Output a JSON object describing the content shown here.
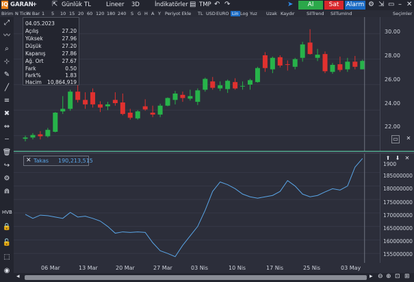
{
  "toolbar": {
    "symbol": "GARAN",
    "plus": "+",
    "period": "Günlük",
    "currency": "TL",
    "scale": "Lineer",
    "mode3d": "3D",
    "indicators": "İndikatörler",
    "template": "TMP",
    "buy": "Al",
    "sell": "Sat",
    "alarm": "Alarm"
  },
  "subbar": {
    "items": [
      "Birim",
      "N Tick",
      "N Bar",
      "1",
      "5",
      "10",
      "15",
      "20",
      "60",
      "120",
      "180",
      "240",
      "S",
      "G",
      "H",
      "A",
      "Y",
      "Periyot Ekle",
      "TL",
      "USD",
      "EURO",
      "Lin",
      "Log",
      "Yuz",
      "Uzak",
      "Kaydır",
      "SilTrend",
      "SilTumInd"
    ],
    "active": "Lin",
    "right_label": "Seçimler"
  },
  "info": {
    "date": "04.05.2023",
    "rows": [
      {
        "label": "Açılış",
        "value": "27.20"
      },
      {
        "label": "Yüksek",
        "value": "27.96"
      },
      {
        "label": "Düşük",
        "value": "27.20"
      },
      {
        "label": "Kapanış",
        "value": "27.86"
      },
      {
        "label": "Ağ. Ort",
        "value": "27.67"
      },
      {
        "label": "Fark",
        "value": "0.50"
      },
      {
        "label": "Fark%",
        "value": "1.83"
      },
      {
        "label": "Hacim",
        "value": "10,864,919"
      }
    ]
  },
  "indicator": {
    "name": "Takas",
    "value": "190,213,515",
    "color": "#5aa6e8"
  },
  "colors": {
    "up": "#27b34a",
    "down": "#e0312f",
    "accent": "#56c9a0",
    "line": "#5aa6e8"
  },
  "icons": {
    "left_tools": [
      "expand-icon",
      "trend-icon",
      "zoom-icon",
      "crosshair-icon",
      "pencil-icon",
      "line-tool-icon",
      "fibonacci-icon",
      "eraser-icon",
      "measure-icon",
      "trash-icon",
      "arrow-icon",
      "magnet-icon",
      "lock-icon",
      "eye-icon",
      "settings-icon"
    ],
    "top_right": [
      "gear-icon",
      "pin-icon",
      "window-icon"
    ]
  },
  "left_hvb": "HVB",
  "chart_data": [
    {
      "type": "candlestick",
      "title": "",
      "x": [
        "2023-02-28",
        "2023-03-01",
        "2023-03-02",
        "2023-03-03",
        "2023-03-06",
        "2023-03-07",
        "2023-03-08",
        "2023-03-09",
        "2023-03-10",
        "2023-03-13",
        "2023-03-14",
        "2023-03-15",
        "2023-03-16",
        "2023-03-17",
        "2023-03-20",
        "2023-03-21",
        "2023-03-22",
        "2023-03-23",
        "2023-03-24",
        "2023-03-27",
        "2023-03-28",
        "2023-03-29",
        "2023-03-30",
        "2023-03-31",
        "2023-04-03",
        "2023-04-04",
        "2023-04-05",
        "2023-04-06",
        "2023-04-07",
        "2023-04-10",
        "2023-04-11",
        "2023-04-12",
        "2023-04-13",
        "2023-04-14",
        "2023-04-17",
        "2023-04-18",
        "2023-04-19",
        "2023-04-20",
        "2023-04-21",
        "2023-04-25",
        "2023-04-26",
        "2023-04-27",
        "2023-04-28",
        "2023-05-02",
        "2023-05-03",
        "2023-05-04"
      ],
      "ohlc": [
        [
          21.75,
          22.0,
          21.55,
          21.85
        ],
        [
          21.85,
          22.2,
          21.7,
          22.05
        ],
        [
          22.1,
          22.35,
          21.7,
          21.95
        ],
        [
          21.95,
          22.6,
          21.85,
          22.45
        ],
        [
          22.3,
          23.85,
          22.25,
          23.8
        ],
        [
          23.9,
          25.1,
          23.7,
          24.1
        ],
        [
          24.1,
          25.6,
          23.95,
          25.45
        ],
        [
          25.45,
          26.2,
          24.6,
          24.8
        ],
        [
          24.8,
          25.4,
          24.1,
          24.45
        ],
        [
          25.4,
          25.7,
          24.2,
          24.45
        ],
        [
          24.45,
          24.7,
          23.85,
          24.2
        ],
        [
          24.3,
          24.65,
          24.0,
          24.45
        ],
        [
          24.8,
          25.4,
          24.35,
          24.55
        ],
        [
          24.6,
          25.3,
          23.6,
          23.7
        ],
        [
          23.8,
          24.1,
          23.25,
          23.4
        ],
        [
          23.35,
          24.0,
          23.25,
          23.9
        ],
        [
          24.3,
          24.85,
          23.95,
          24.05
        ],
        [
          23.8,
          24.35,
          23.45,
          23.65
        ],
        [
          23.65,
          24.5,
          23.45,
          24.35
        ],
        [
          24.35,
          25.0,
          24.3,
          24.95
        ],
        [
          24.8,
          25.5,
          24.45,
          25.3
        ],
        [
          25.2,
          25.45,
          24.65,
          24.95
        ],
        [
          24.9,
          25.6,
          24.75,
          25.1
        ],
        [
          24.65,
          25.7,
          24.4,
          25.55
        ],
        [
          25.6,
          26.55,
          25.45,
          26.45
        ],
        [
          26.25,
          26.6,
          25.6,
          25.75
        ],
        [
          25.7,
          26.25,
          25.5,
          25.95
        ],
        [
          25.65,
          26.4,
          25.35,
          26.3
        ],
        [
          26.2,
          26.5,
          25.6,
          25.7
        ],
        [
          25.85,
          26.25,
          25.6,
          25.9
        ],
        [
          26.0,
          26.45,
          25.6,
          26.35
        ],
        [
          26.2,
          27.4,
          26.15,
          27.3
        ],
        [
          28.3,
          28.55,
          27.0,
          27.3
        ],
        [
          27.2,
          28.2,
          26.9,
          28.1
        ],
        [
          28.15,
          28.3,
          27.35,
          27.5
        ],
        [
          27.6,
          27.9,
          27.1,
          27.55
        ],
        [
          27.4,
          28.1,
          27.2,
          28.0
        ],
        [
          28.1,
          29.35,
          27.8,
          29.15
        ],
        [
          29.3,
          30.35,
          28.35,
          28.4
        ],
        [
          28.1,
          28.8,
          27.85,
          28.35
        ],
        [
          28.4,
          28.6,
          26.9,
          27.05
        ],
        [
          27.0,
          27.7,
          26.85,
          27.55
        ],
        [
          27.6,
          28.2,
          27.0,
          27.15
        ],
        [
          27.2,
          28.1,
          27.0,
          27.8
        ],
        [
          27.8,
          28.25,
          27.2,
          27.4
        ],
        [
          27.2,
          27.96,
          27.2,
          27.86
        ]
      ],
      "ylim": [
        20.8,
        31.3
      ],
      "yticks": [
        22.0,
        24.0,
        26.0,
        28.0,
        30.0
      ]
    },
    {
      "type": "line",
      "series": [
        {
          "name": "Takas",
          "values": [
            169500000,
            168000000,
            169200000,
            169000000,
            168500000,
            168000000,
            170200000,
            168500000,
            168800000,
            168000000,
            167000000,
            165000000,
            162500000,
            163000000,
            162800000,
            163000000,
            162800000,
            159000000,
            156000000,
            155000000,
            153800000,
            158000000,
            161500000,
            165000000,
            171000000,
            178000000,
            181500000,
            180500000,
            179000000,
            177000000,
            176000000,
            175500000,
            176000000,
            176500000,
            178000000,
            182000000,
            180000000,
            177000000,
            176000000,
            176500000,
            177800000,
            179000000,
            178500000,
            180000000,
            187000000,
            190213515
          ]
        }
      ],
      "ylim": [
        151500000,
        192000000
      ],
      "yticks": [
        155000000,
        160000000,
        165000000,
        170000000,
        175000000,
        180000000,
        185000000
      ]
    }
  ],
  "x_labels": [
    "06 Mar",
    "13 Mar",
    "20 Mar",
    "27 Mar",
    "03 Nis",
    "10 Nis",
    "17 Nis",
    "25 Nis",
    "03 May"
  ],
  "y_labels_top": [
    "30.00",
    "28.00",
    "26.00",
    "24.00",
    "22.00"
  ],
  "y_labels_bottom": [
    "185000000",
    "180000000",
    "175000000",
    "170000000",
    "165000000",
    "160000000",
    "155000000"
  ]
}
